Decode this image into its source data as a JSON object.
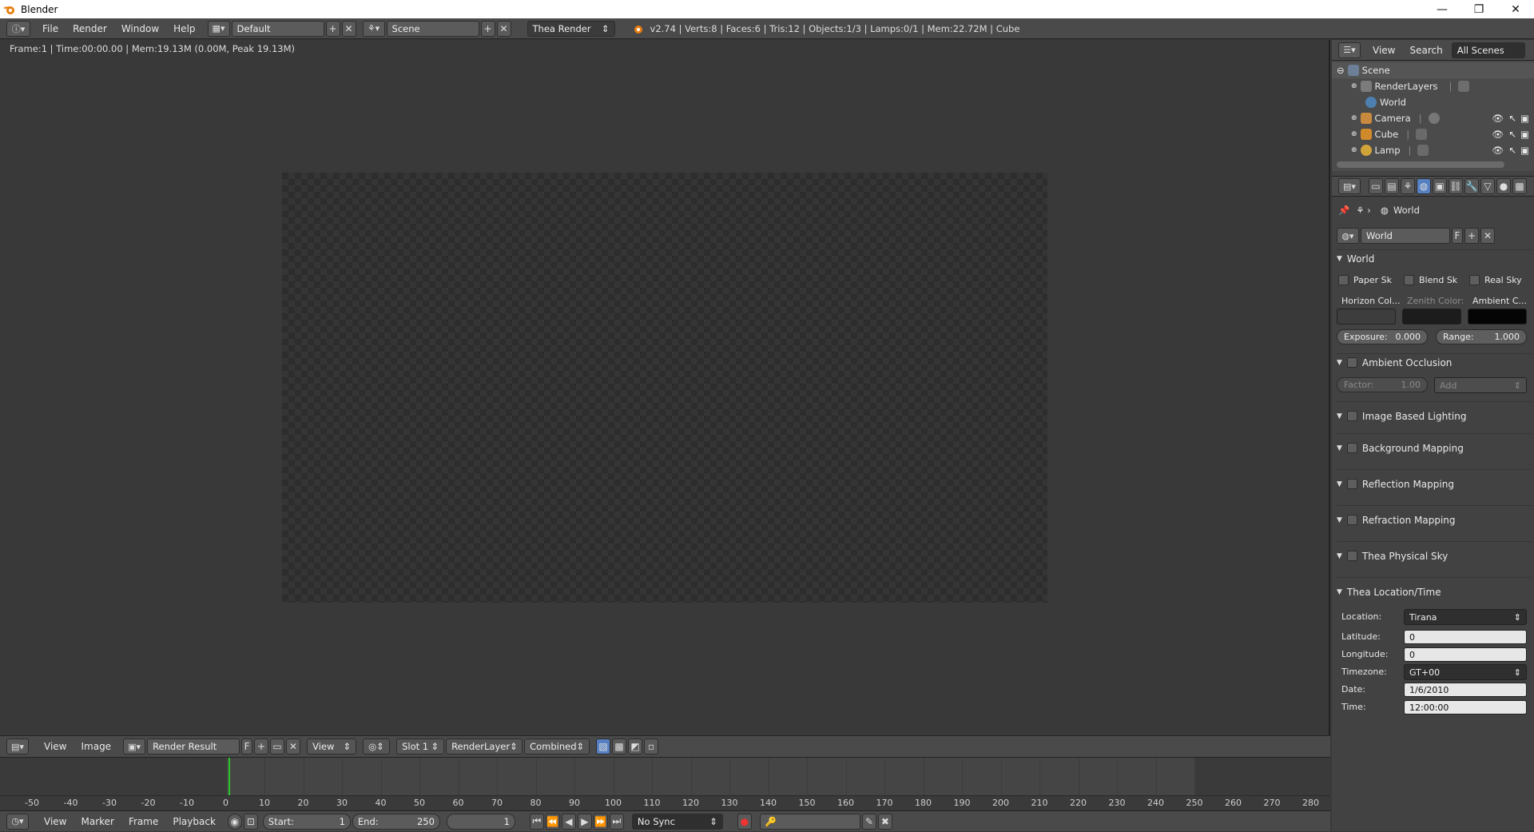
{
  "window": {
    "title": "Blender",
    "minimize": "—",
    "maximize": "❐",
    "close": "✕"
  },
  "menu": {
    "file": "File",
    "render": "Render",
    "window": "Window",
    "help": "Help"
  },
  "layout": {
    "screen": "Default",
    "scene": "Scene",
    "engine": "Thea Render"
  },
  "stats": "v2.74 | Verts:8 | Faces:6 | Tris:12 | Objects:1/3 | Lamps:0/1 | Mem:22.72M | Cube",
  "viewport": {
    "frame_info": "Frame:1 | Time:00:00.00 | Mem:19.13M (0.00M, Peak 19.13M)"
  },
  "image_header": {
    "view": "View",
    "image": "Image",
    "image_name": "Render Result",
    "f": "F",
    "view_mode": "View",
    "slot": "Slot 1",
    "layer": "RenderLayer",
    "pass": "Combined"
  },
  "timeline": {
    "ticks": [
      "-50",
      "-40",
      "-30",
      "-20",
      "-10",
      "0",
      "10",
      "20",
      "30",
      "40",
      "50",
      "60",
      "70",
      "80",
      "90",
      "100",
      "110",
      "120",
      "130",
      "140",
      "150",
      "160",
      "170",
      "180",
      "190",
      "200",
      "210",
      "220",
      "230",
      "240",
      "250",
      "260",
      "270",
      "280"
    ],
    "current_frame": 1,
    "end": 250
  },
  "timeline_header": {
    "view": "View",
    "marker": "Marker",
    "frame": "Frame",
    "playback": "Playback",
    "start_label": "Start:",
    "start_value": "1",
    "end_label": "End:",
    "end_value": "250",
    "current": "1",
    "sync": "No Sync"
  },
  "outliner": {
    "view": "View",
    "search": "Search",
    "scenes": "All Scenes",
    "items": [
      {
        "name": "Scene"
      },
      {
        "name": "RenderLayers"
      },
      {
        "name": "World"
      },
      {
        "name": "Camera"
      },
      {
        "name": "Cube"
      },
      {
        "name": "Lamp"
      }
    ]
  },
  "properties": {
    "breadcrumb": "World",
    "world_name": "World",
    "f": "F",
    "world_panel": {
      "title": "World",
      "paper_sky": "Paper Sk",
      "blend_sky": "Blend Sk",
      "real_sky": "Real Sky",
      "horizon": "Horizon Col...",
      "zenith": "Zenith Color:",
      "ambient": "Ambient C...",
      "exposure_label": "Exposure:",
      "exposure_value": "0.000",
      "range_label": "Range:",
      "range_value": "1.000",
      "horizon_color": "#3d3d3d",
      "zenith_color": "#1c1c1c",
      "ambient_color": "#050505"
    },
    "ao": {
      "title": "Ambient Occlusion",
      "factor_label": "Factor:",
      "factor_value": "1.00",
      "mode": "Add"
    },
    "ibl": "Image Based Lighting",
    "bg": "Background Mapping",
    "refl": "Reflection Mapping",
    "refr": "Refraction Mapping",
    "sky": "Thea Physical Sky",
    "loc": {
      "title": "Thea Location/Time",
      "location_label": "Location:",
      "location": "Tirana",
      "lat_label": "Latitude:",
      "lat": "0",
      "lon_label": "Longitude:",
      "lon": "0",
      "tz_label": "Timezone:",
      "tz": "GT+00",
      "date_label": "Date:",
      "date": "1/6/2010",
      "time_label": "Time:",
      "time": "12:00:00"
    }
  }
}
